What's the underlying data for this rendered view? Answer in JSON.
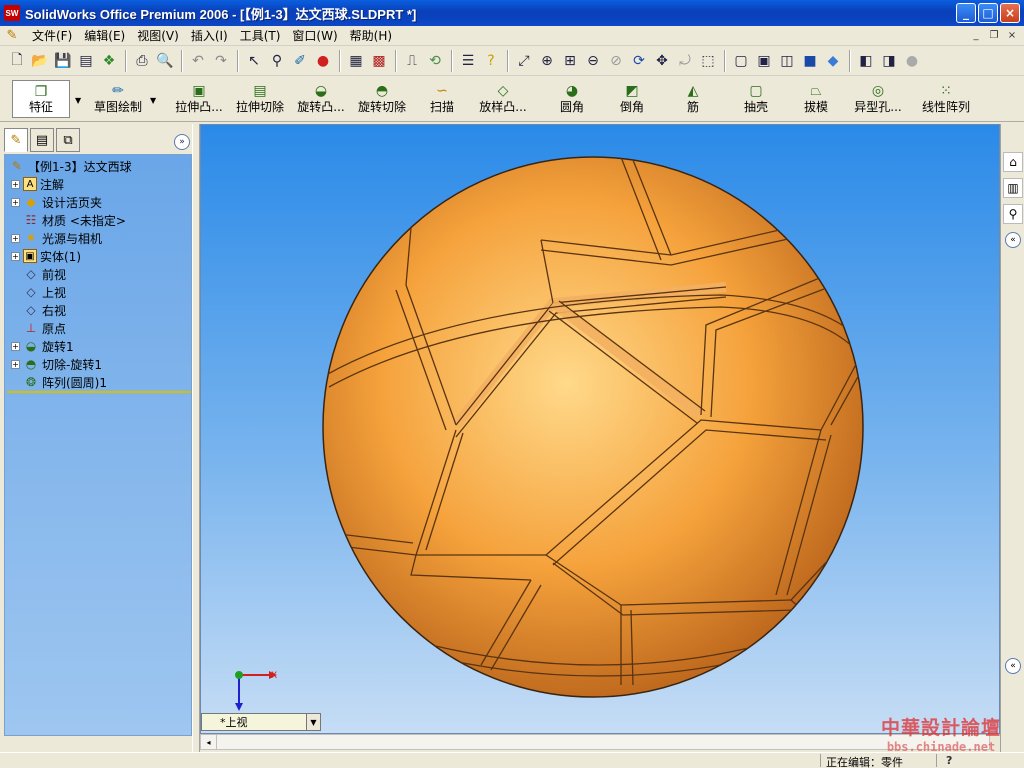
{
  "window": {
    "title": "SolidWorks Office Premium 2006 - [【例1-3】达文西球.SLDPRT *]",
    "app_badge": "SW",
    "minimize": "_",
    "maximize": "□",
    "close": "×"
  },
  "menu": {
    "items": [
      "文件(F)",
      "编辑(E)",
      "视图(V)",
      "插入(I)",
      "工具(T)",
      "窗口(W)",
      "帮助(H)"
    ],
    "mdi_minimize": "_",
    "mdi_restore": "❐",
    "mdi_close": "×"
  },
  "standard_toolbar": {
    "icons": [
      "new-icon",
      "open-icon",
      "save-icon",
      "print-icon",
      "undo-icon",
      "redo-icon",
      "select-icon",
      "zoom-icon",
      "rotate-icon",
      "pan-icon",
      "view-icon"
    ]
  },
  "command_manager": {
    "features_label": "特征",
    "sketch_label": "草图绘制",
    "buttons": [
      {
        "label": "拉伸凸..."
      },
      {
        "label": "拉伸切除"
      },
      {
        "label": "旋转凸..."
      },
      {
        "label": "旋转切除"
      },
      {
        "label": "扫描"
      },
      {
        "label": "放样凸..."
      },
      {
        "label": "圆角"
      },
      {
        "label": "倒角"
      },
      {
        "label": "筋"
      },
      {
        "label": "抽壳"
      },
      {
        "label": "拔模"
      },
      {
        "label": "异型孔..."
      },
      {
        "label": "线性阵列"
      }
    ]
  },
  "feature_tree": {
    "collapse": "»",
    "root": "【例1-3】达文西球",
    "items": [
      {
        "label": "注解",
        "expandable": true,
        "icon": "annotation-icon"
      },
      {
        "label": "设计活页夹",
        "expandable": true,
        "icon": "design-binder-icon"
      },
      {
        "label": "材质 <未指定>",
        "expandable": false,
        "icon": "material-icon"
      },
      {
        "label": "光源与相机",
        "expandable": true,
        "icon": "lights-camera-icon"
      },
      {
        "label": "实体(1)",
        "expandable": true,
        "icon": "solid-bodies-icon"
      },
      {
        "label": "前视",
        "expandable": false,
        "icon": "plane-icon"
      },
      {
        "label": "上视",
        "expandable": false,
        "icon": "plane-icon"
      },
      {
        "label": "右视",
        "expandable": false,
        "icon": "plane-icon"
      },
      {
        "label": "原点",
        "expandable": false,
        "icon": "origin-icon"
      },
      {
        "label": "旋转1",
        "expandable": true,
        "icon": "revolve-icon"
      },
      {
        "label": "切除-旋转1",
        "expandable": true,
        "icon": "cut-revolve-icon"
      },
      {
        "label": "阵列(圆周)1",
        "expandable": false,
        "icon": "circular-pattern-icon"
      }
    ]
  },
  "viewport": {
    "current_view": "*上视",
    "triad_x": "X",
    "triad_z": "Z",
    "colors": {
      "ball_light": "#ffd98a",
      "ball_mid": "#f5a23c",
      "ball_dark": "#b8621a"
    }
  },
  "status_bar": {
    "status": "正在编辑：零件",
    "help": "?"
  },
  "watermark": {
    "line1": "中華設計論壇",
    "line2": "bbs.chinade.net"
  }
}
